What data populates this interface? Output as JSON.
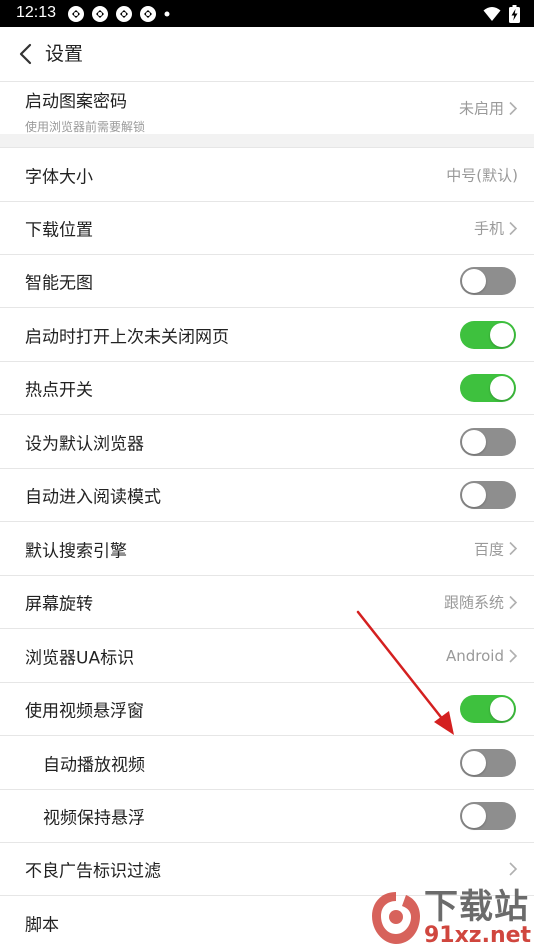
{
  "status_bar": {
    "time": "12:13"
  },
  "header": {
    "title": "设置"
  },
  "settings": {
    "pattern_lock": {
      "label": "启动图案密码",
      "sublabel": "使用浏览器前需要解锁",
      "value": "未启用"
    },
    "font_size": {
      "label": "字体大小",
      "value": "中号(默认)"
    },
    "download_location": {
      "label": "下载位置",
      "value": "手机"
    },
    "smart_no_image": {
      "label": "智能无图",
      "enabled": false
    },
    "restore_tabs": {
      "label": "启动时打开上次未关闭网页",
      "enabled": true
    },
    "hotspot": {
      "label": "热点开关",
      "enabled": true
    },
    "default_browser": {
      "label": "设为默认浏览器",
      "enabled": false
    },
    "reading_mode": {
      "label": "自动进入阅读模式",
      "enabled": false
    },
    "search_engine": {
      "label": "默认搜索引擎",
      "value": "百度"
    },
    "screen_rotation": {
      "label": "屏幕旋转",
      "value": "跟随系统"
    },
    "ua": {
      "label": "浏览器UA标识",
      "value": "Android"
    },
    "video_float": {
      "label": "使用视频悬浮窗",
      "enabled": true
    },
    "auto_play_video": {
      "label": "自动播放视频",
      "enabled": false
    },
    "keep_float": {
      "label": "视频保持悬浮",
      "enabled": false
    },
    "ad_filter": {
      "label": "不良广告标识过滤"
    },
    "scripts": {
      "label": "脚本"
    }
  },
  "watermark": {
    "text": "下载站",
    "url": "91xz.net"
  },
  "colors": {
    "toggle_on": "#3ec13e",
    "toggle_off": "#8e8e8e",
    "annotation_arrow": "#d42020",
    "watermark_red": "#d0463e"
  },
  "icons": {
    "back": "chevron-left-icon",
    "row_arrow": "chevron-right-icon",
    "annotation": "red-arrow-annotation"
  }
}
